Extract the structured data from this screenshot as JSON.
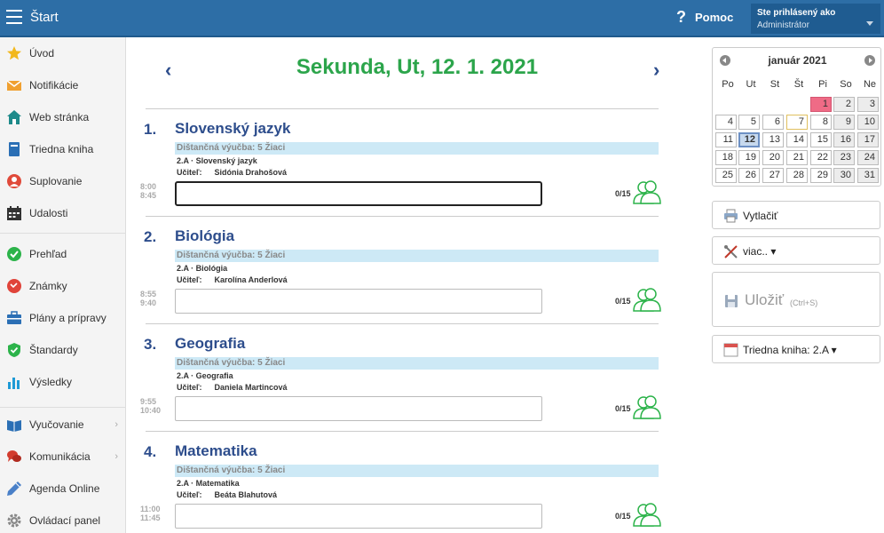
{
  "topbar": {
    "title": "Štart",
    "help_label": "Pomoc",
    "user_caption": "Ste prihlásený ako",
    "user_name": "Administrátor"
  },
  "sidebar": {
    "items": [
      {
        "label": "Úvod",
        "icon": "star-icon"
      },
      {
        "label": "Notifikácie",
        "icon": "envelope-icon"
      },
      {
        "label": "Web stránka",
        "icon": "home-icon"
      },
      {
        "label": "Triedna kniha",
        "icon": "book-icon"
      },
      {
        "label": "Suplovanie",
        "icon": "user-substitute-icon"
      },
      {
        "label": "Udalosti",
        "icon": "calendar-icon"
      },
      {
        "label": "Prehľad",
        "icon": "check-circle-icon"
      },
      {
        "label": "Známky",
        "icon": "grades-icon"
      },
      {
        "label": "Plány a prípravy",
        "icon": "briefcase-icon"
      },
      {
        "label": "Štandardy",
        "icon": "shield-check-icon"
      },
      {
        "label": "Výsledky",
        "icon": "bar-chart-icon"
      },
      {
        "label": "Vyučovanie",
        "icon": "open-book-icon"
      },
      {
        "label": "Komunikácia",
        "icon": "chat-icon"
      },
      {
        "label": "Agenda Online",
        "icon": "pen-icon"
      },
      {
        "label": "Ovládací panel",
        "icon": "gear-icon"
      }
    ]
  },
  "main": {
    "title": "Sekunda, Ut, 12. 1. 2021",
    "lessons": [
      {
        "num": "1.",
        "subject": "Slovenský jazyk",
        "band": "Dištančná výučba: 5 Žiaci",
        "class": "2.A · Slovenský jazyk",
        "teacher_label": "Učiteľ:",
        "teacher": "Sidónia Drahošová",
        "time_start": "8:00",
        "time_end": "8:45",
        "count": "0/15"
      },
      {
        "num": "2.",
        "subject": "Biológia",
        "band": "Dištančná výučba: 5 Žiaci",
        "class": "2.A · Biológia",
        "teacher_label": "Učiteľ:",
        "teacher": "Karolína Anderlová",
        "time_start": "8:55",
        "time_end": "9:40",
        "count": "0/15"
      },
      {
        "num": "3.",
        "subject": "Geografia",
        "band": "Dištančná výučba: 5 Žiaci",
        "class": "2.A · Geografia",
        "teacher_label": "Učiteľ:",
        "teacher": "Daniela Martincová",
        "time_start": "9:55",
        "time_end": "10:40",
        "count": "0/15"
      },
      {
        "num": "4.",
        "subject": "Matematika",
        "band": "Dištančná výučba: 5 Žiaci",
        "class": "2.A · Matematika",
        "teacher_label": "Učiteľ:",
        "teacher": "Beáta Blahutová",
        "time_start": "11:00",
        "time_end": "11:45",
        "count": "0/15"
      }
    ]
  },
  "calendar": {
    "month": "január 2021",
    "weekdays": [
      "Po",
      "Ut",
      "St",
      "Št",
      "Pi",
      "So",
      "Ne"
    ],
    "weeks": [
      [
        "",
        "",
        "",
        "",
        "1",
        "2",
        "3"
      ],
      [
        "4",
        "5",
        "6",
        "7",
        "8",
        "9",
        "10"
      ],
      [
        "11",
        "12",
        "13",
        "14",
        "15",
        "16",
        "17"
      ],
      [
        "18",
        "19",
        "20",
        "21",
        "22",
        "23",
        "24"
      ],
      [
        "25",
        "26",
        "27",
        "28",
        "29",
        "30",
        "31"
      ]
    ],
    "selected_day": "12",
    "holiday_day": "1",
    "colors": {
      "holiday": "#ef6b86",
      "selected": "#c7d9ee",
      "weekend": "#ececec"
    }
  },
  "actions": {
    "print_label": "Vytlačiť",
    "more_label": "viac.. ▾",
    "save_label": "Uložiť",
    "save_hint": "(Ctrl+S)",
    "classbook_label": "Triedna kniha: 2.A ▾"
  },
  "colors": {
    "topbar": "#2d6ea6",
    "title_green": "#2ca54b",
    "subject_blue": "#2d4d8c"
  }
}
